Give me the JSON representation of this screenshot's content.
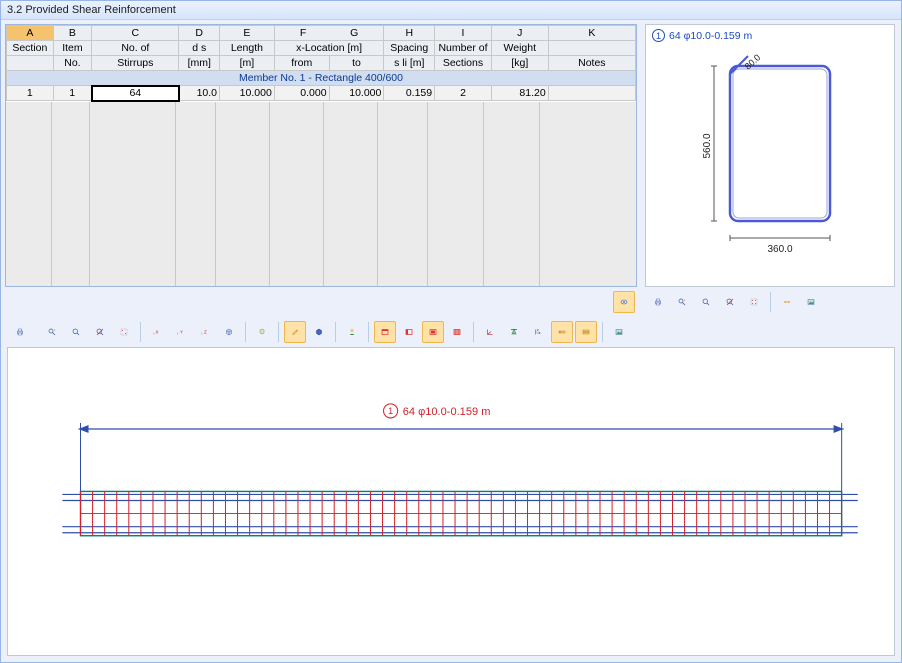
{
  "title": "3.2  Provided Shear Reinforcement",
  "table": {
    "col_letters": [
      "A",
      "B",
      "C",
      "D",
      "E",
      "F",
      "G",
      "H",
      "I",
      "J",
      "K"
    ],
    "header1": [
      "Section",
      "Item",
      "No. of",
      "d s",
      "Length",
      "x-Location [m]",
      "",
      "Spacing",
      "Number of",
      "Weight",
      ""
    ],
    "header2": [
      "",
      "No.",
      "Stirrups",
      "[mm]",
      "[m]",
      "from",
      "to",
      "s li [m]",
      "Sections",
      "[kg]",
      "Notes"
    ],
    "member_row": "Member No. 1  -  Rectangle 400/600",
    "row": [
      "1",
      "1",
      "64",
      "10.0",
      "10.000",
      "0.000",
      "10.000",
      "0.159",
      "2",
      "81.20",
      ""
    ]
  },
  "cross_section": {
    "label_num": "1",
    "label_text": "64 φ10.0-0.159 m",
    "width": "360.0",
    "height": "560.0",
    "corner": "80.0"
  },
  "elevation": {
    "label_num": "1",
    "label_text": "64 φ10.0-0.159 m"
  },
  "chart_data": {
    "type": "table",
    "title": "3.2 Provided Shear Reinforcement",
    "columns": [
      "Section",
      "Item No.",
      "No. of Stirrups",
      "d_s [mm]",
      "Length [m]",
      "x-Location from [m]",
      "x-Location to [m]",
      "Spacing s_li [m]",
      "Number of Sections",
      "Weight [kg]",
      "Notes"
    ],
    "rows": [
      {
        "member": "Member No. 1 - Rectangle 400/600",
        "data": [
          1,
          1,
          64,
          10.0,
          10.0,
          0.0,
          10.0,
          0.159,
          2,
          81.2,
          ""
        ]
      }
    ],
    "cross_section": {
      "width_mm": 360.0,
      "height_mm": 560.0,
      "corner_chamfer_mm": 80.0,
      "bar_note": "64 φ10.0-0.159 m"
    }
  }
}
